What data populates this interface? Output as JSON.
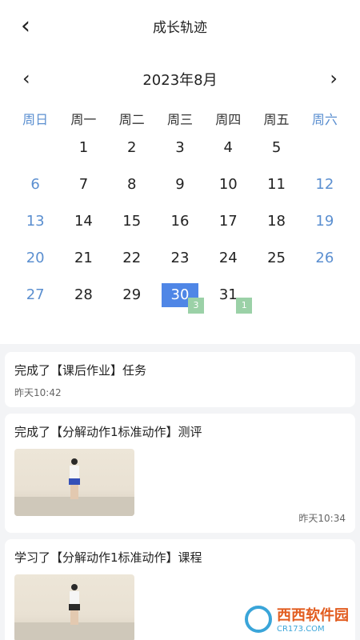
{
  "header": {
    "back_icon": "chevron-left-icon",
    "title": "成长轨迹"
  },
  "calendar": {
    "month_label": "2023年8月",
    "weekdays": [
      "周日",
      "周一",
      "周二",
      "周三",
      "周四",
      "周五",
      "周六"
    ],
    "weeks": [
      [
        null,
        "1",
        "2",
        "3",
        "4",
        "5",
        null
      ],
      [
        "6",
        "7",
        "8",
        "9",
        "10",
        "11",
        "12"
      ],
      [
        "13",
        "14",
        "15",
        "16",
        "17",
        "18",
        "19"
      ],
      [
        "20",
        "21",
        "22",
        "23",
        "24",
        "25",
        "26"
      ],
      [
        "27",
        "28",
        "29",
        "30",
        "31",
        null,
        null
      ]
    ],
    "selected_day": "30",
    "badges": {
      "30": "3",
      "31": "1"
    },
    "colors": {
      "accent": "#4f86e6",
      "weekend": "#5b8fd0",
      "badge": "#9bd1a7"
    }
  },
  "feed": {
    "items": [
      {
        "title": "完成了【课后作业】任务",
        "time": "昨天10:42",
        "has_image": false
      },
      {
        "title": "完成了【分解动作1标准动作】测评",
        "time": "昨天10:34",
        "has_image": true
      },
      {
        "title": "学习了【分解动作1标准动作】课程",
        "time": "",
        "has_image": true
      }
    ]
  },
  "watermark": {
    "text": "西西软件园",
    "sub": "CR173.COM"
  }
}
